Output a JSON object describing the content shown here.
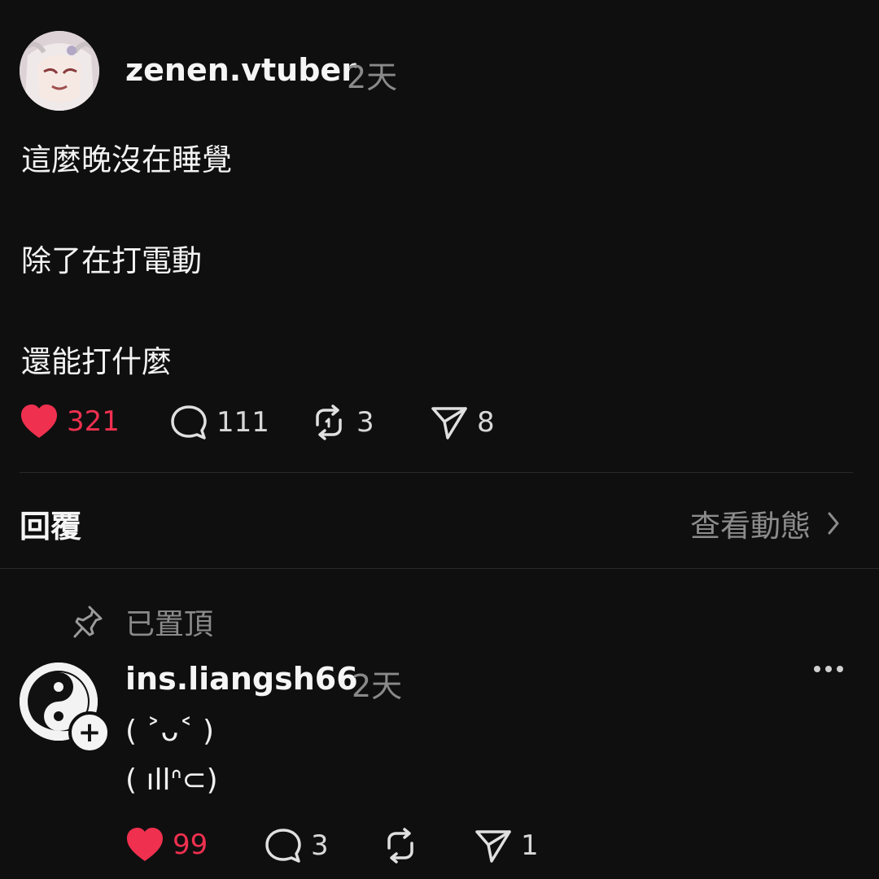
{
  "post": {
    "username": "zenen.vtuber",
    "time": "2天",
    "lines": [
      "這麼晚沒在睡覺",
      "除了在打電動",
      "還能打什麼"
    ],
    "likes": "321",
    "comments": "111",
    "reposts": "3",
    "shares": "8",
    "liked": true
  },
  "replies_section": {
    "title": "回覆",
    "view_activity": "查看動態"
  },
  "reply": {
    "pinned_label": "已置頂",
    "username": "ins.liangsh66",
    "time": "2天",
    "lines": [
      "( ˃ᴗ˂ )",
      "( ıllᐢ⊂)"
    ],
    "likes": "99",
    "comments": "3",
    "shares": "1",
    "liked": true,
    "follow_badge": "+"
  },
  "colors": {
    "background": "#0f0f10",
    "like_red": "#f0304f",
    "muted_text": "#8a8a8a"
  },
  "icons": [
    "heart-icon",
    "comment-icon",
    "repost-icon",
    "share-icon",
    "pin-icon",
    "chevron-right-icon",
    "more-icon",
    "plus-icon"
  ]
}
